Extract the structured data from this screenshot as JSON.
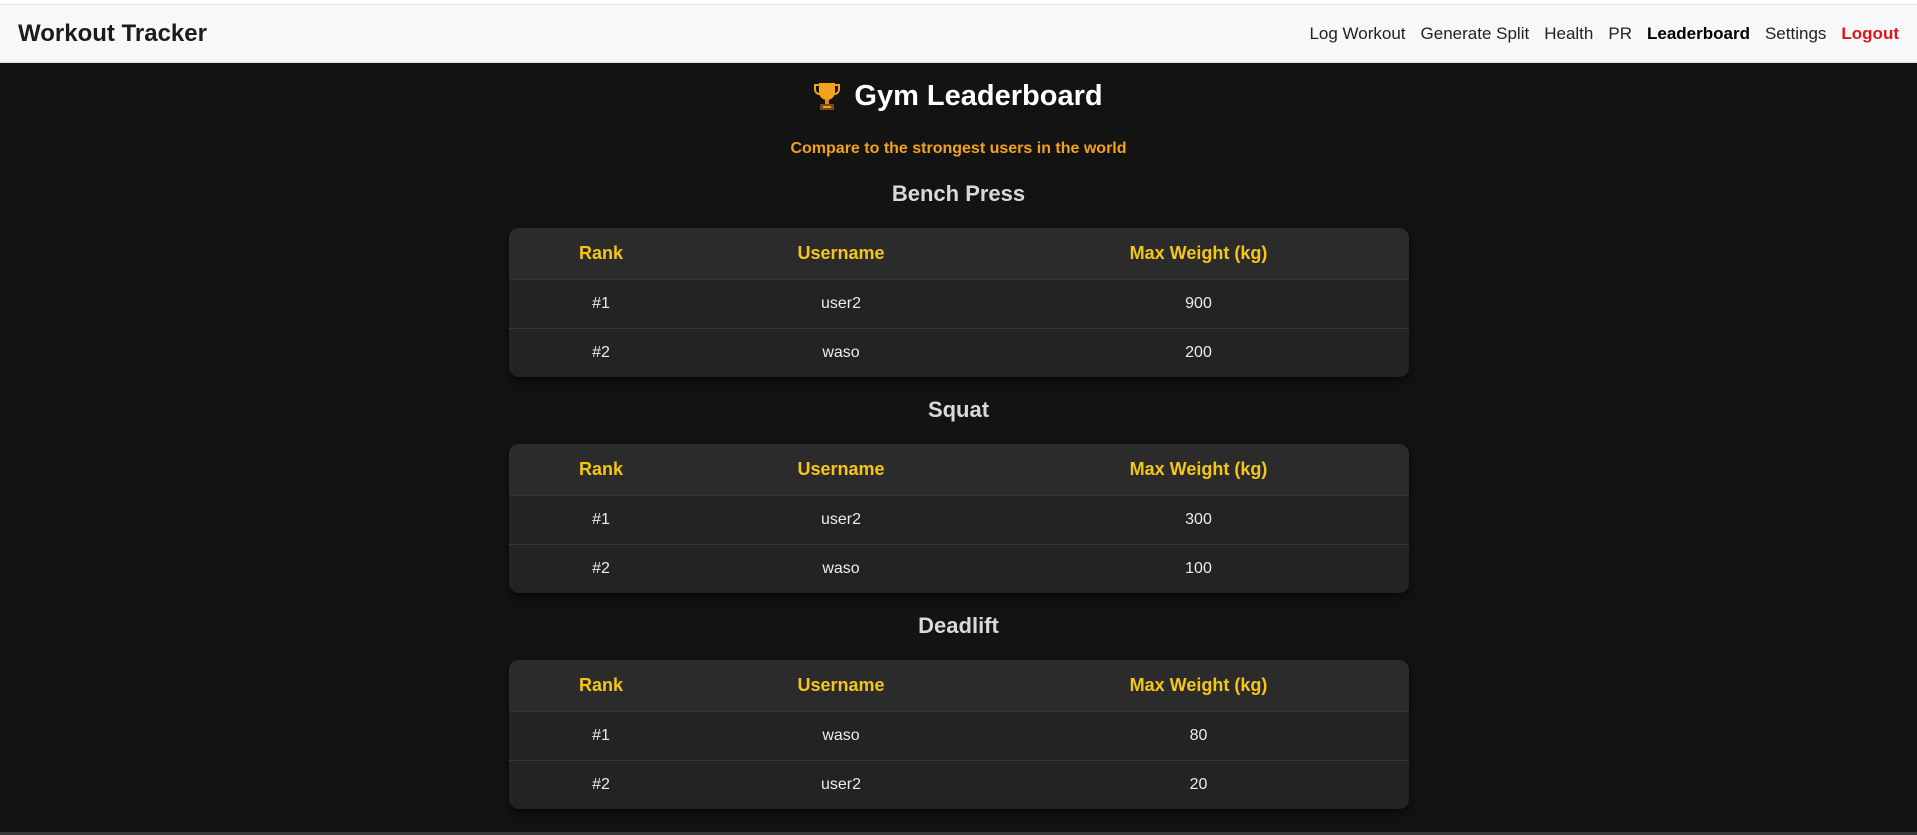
{
  "navbar": {
    "brand": "Workout Tracker",
    "links": [
      {
        "label": "Log Workout"
      },
      {
        "label": "Generate Split"
      },
      {
        "label": "Health"
      },
      {
        "label": "PR"
      },
      {
        "label": "Leaderboard"
      },
      {
        "label": "Settings"
      },
      {
        "label": "Logout"
      }
    ],
    "active": "Leaderboard"
  },
  "page": {
    "title": "Gym Leaderboard",
    "title_icon": "trophy-icon",
    "subtitle": "Compare to the strongest users in the world"
  },
  "columns": [
    "Rank",
    "Username",
    "Max Weight (kg)"
  ],
  "boards": [
    {
      "exercise": "Bench Press",
      "rows": [
        {
          "rank": "#1",
          "username": "user2",
          "max": "900"
        },
        {
          "rank": "#2",
          "username": "waso",
          "max": "200"
        }
      ]
    },
    {
      "exercise": "Squat",
      "rows": [
        {
          "rank": "#1",
          "username": "user2",
          "max": "300"
        },
        {
          "rank": "#2",
          "username": "waso",
          "max": "100"
        }
      ]
    },
    {
      "exercise": "Deadlift",
      "rows": [
        {
          "rank": "#1",
          "username": "waso",
          "max": "80"
        },
        {
          "rank": "#2",
          "username": "user2",
          "max": "20"
        }
      ]
    }
  ],
  "colors": {
    "background": "#131313",
    "header_text": "#f5c518",
    "subtitle": "#f4a21a",
    "logout": "#e0131b"
  }
}
